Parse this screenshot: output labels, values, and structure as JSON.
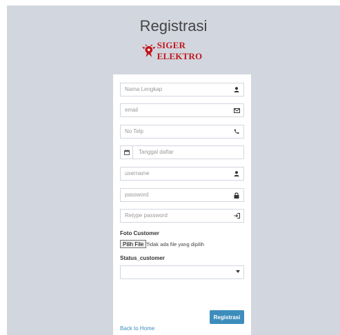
{
  "header": {
    "title": "Registrasi",
    "logo_text": "SIGER ELEKTRO"
  },
  "form": {
    "fields": [
      {
        "placeholder": "Nama Lengkap",
        "icon": "user-icon"
      },
      {
        "placeholder": "email",
        "icon": "envelope-icon"
      },
      {
        "placeholder": "No Telp",
        "icon": "phone-icon"
      },
      {
        "placeholder": "Tanggal daftar",
        "icon": "calendar-icon"
      },
      {
        "placeholder": "username",
        "icon": "user-icon"
      },
      {
        "placeholder": "password",
        "icon": "lock-icon"
      },
      {
        "placeholder": "Retype password",
        "icon": "sign-in-icon"
      }
    ],
    "foto_label": "Foto Customer",
    "file_button": "Pilih File",
    "file_status": "Tidak ada file yang dipilih",
    "status_label": "Status_customer",
    "status_value": "",
    "submit_label": "Registrasi",
    "back_link": "Back to Home"
  },
  "colors": {
    "background": "#d2d6de",
    "primary": "#3c8dbc",
    "logo": "#c0171e"
  }
}
